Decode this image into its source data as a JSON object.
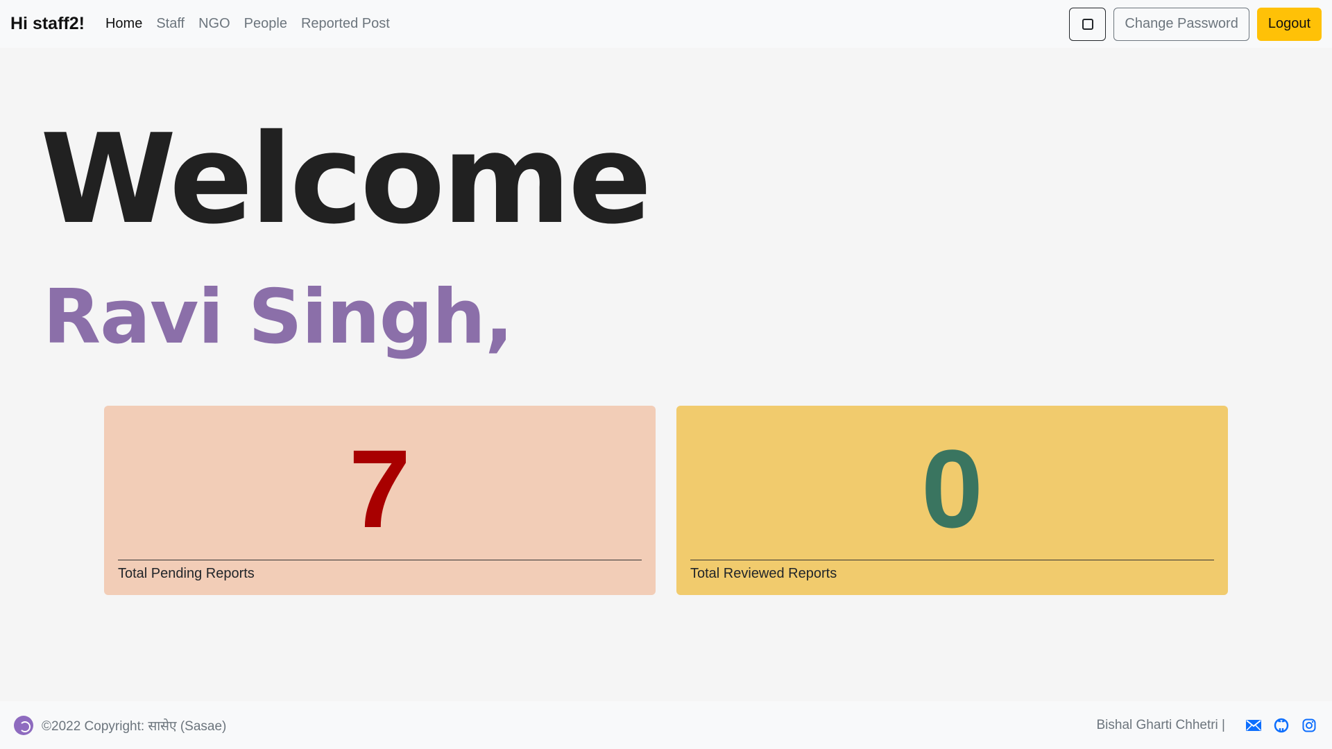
{
  "navbar": {
    "brand": "Hi staff2!",
    "links": [
      "Home",
      "Staff",
      "NGO",
      "People",
      "Reported Post"
    ],
    "change_password": "Change Password",
    "logout": "Logout"
  },
  "hero": {
    "welcome": "Welcome",
    "name": "Ravi Singh,"
  },
  "cards": [
    {
      "value": "7",
      "label": "Total Pending Reports"
    },
    {
      "value": "0",
      "label": "Total Reviewed Reports"
    }
  ],
  "footer": {
    "copyright": "©2022 Copyright: सासेए (Sasae)",
    "author": "Bishal Gharti Chhetri |",
    "icons": [
      "mail-icon",
      "github-icon",
      "instagram-icon"
    ]
  },
  "colors": {
    "accent_purple": "#8b6fa9",
    "pending_bg": "#f2cdb7",
    "pending_fg": "#a80000",
    "reviewed_bg": "#f1cb6d",
    "reviewed_fg": "#3a7560",
    "logout_bg": "#ffc107",
    "social_blue": "#0d6efd"
  }
}
